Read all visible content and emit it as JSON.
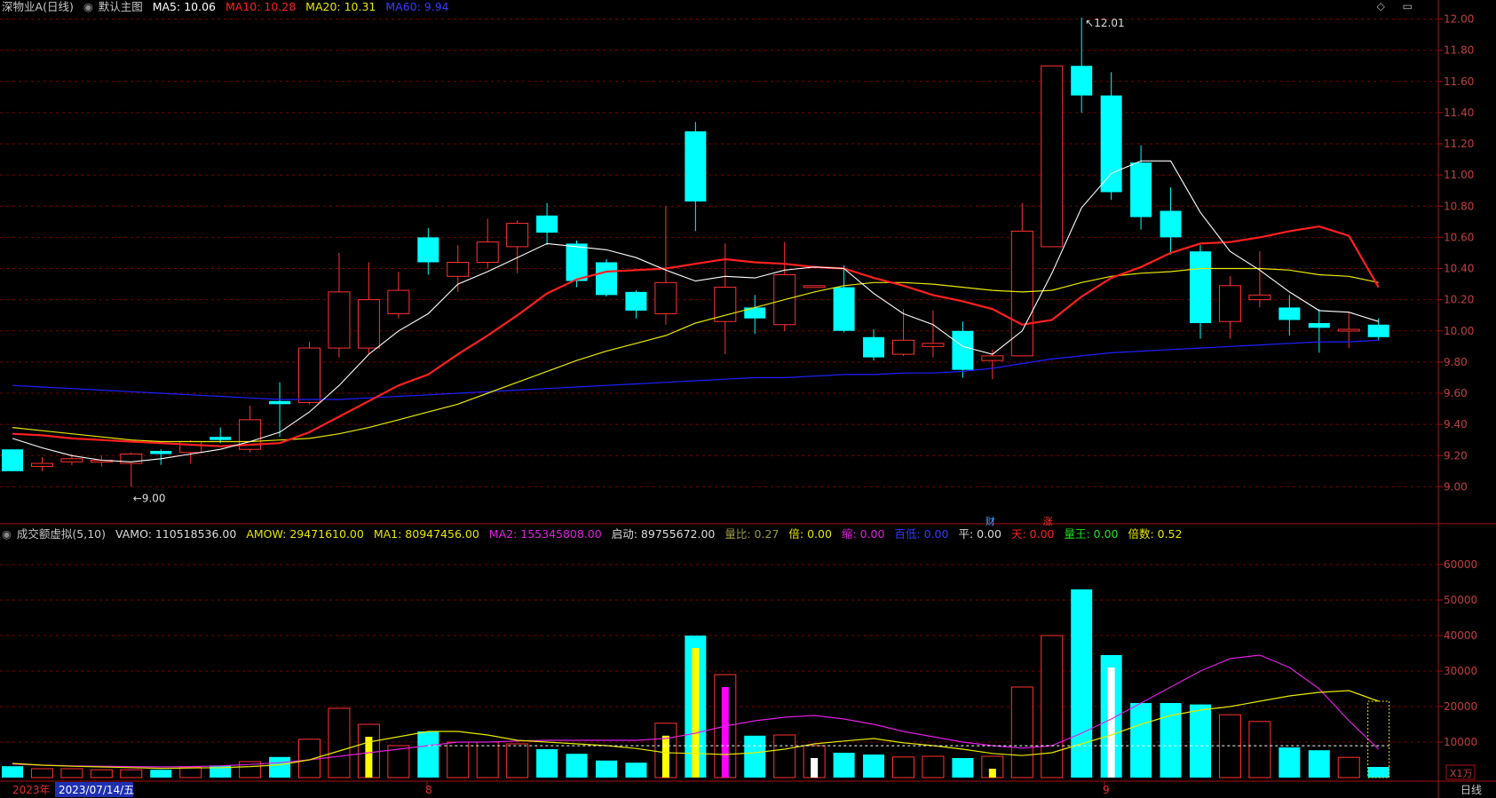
{
  "main_legend": {
    "title": "深物业A",
    "period": "(日线)",
    "mode_label": "默认主图",
    "ma5": "MA5: 10.06",
    "ma10": "MA10: 10.28",
    "ma20": "MA20: 10.31",
    "ma60": "MA60: 9.94"
  },
  "vol_legend": {
    "name": "成交额虚拟(5,10)",
    "vamo": "VAMO: 110518536.00",
    "amow": "AMOW: 29471610.00",
    "ma1": "MA1: 80947456.00",
    "ma2": "MA2: 155345808.00",
    "start": "启动: 89755672.00",
    "ratio": "量比: 0.27",
    "bei": "倍: 0.00",
    "suo": "缩: 0.00",
    "bailow": "百低: 0.00",
    "ping": "平: 0.00",
    "tian": "天: 0.00",
    "liangwang": "量王: 0.00",
    "beishu": "倍数: 0.52"
  },
  "top_icons": "◇ ▭",
  "bottom_bar": {
    "year": "2023年",
    "date_cursor": "2023/07/14/五",
    "month_8": "8",
    "month_9": "9",
    "period_tab": "日线",
    "vol_unit": "X1万"
  },
  "markers": {
    "cai": "财",
    "zhang": "涨"
  },
  "annotations": {
    "high": "12.01",
    "low": "9.00"
  },
  "colors": {
    "up": "#ff3232",
    "down": "#00ffff",
    "ma5": "#ffffff",
    "ma10": "#ff2020",
    "ma20": "#e8e800",
    "ma60": "#2020ff",
    "grid": "#7a0000",
    "axis": "#aa1010",
    "vol_ma1": "#e8e800",
    "vol_ma2": "#e020e0"
  },
  "chart_data": [
    {
      "type": "candlestick",
      "y_ticks": [
        9.0,
        9.2,
        9.4,
        9.6,
        9.8,
        10.0,
        10.2,
        10.4,
        10.6,
        10.8,
        11.0,
        11.2,
        11.4,
        11.6,
        11.8,
        12.0
      ],
      "ylim": [
        8.82,
        12.02
      ],
      "candles": [
        {
          "o": 9.24,
          "c": 9.1,
          "h": 9.24,
          "l": 9.1
        },
        {
          "o": 9.13,
          "c": 9.15,
          "h": 9.19,
          "l": 9.1
        },
        {
          "o": 9.16,
          "c": 9.18,
          "h": 9.21,
          "l": 9.14
        },
        {
          "o": 9.16,
          "c": 9.17,
          "h": 9.2,
          "l": 9.13
        },
        {
          "o": 9.15,
          "c": 9.21,
          "h": 9.22,
          "l": 9.0
        },
        {
          "o": 9.23,
          "c": 9.21,
          "h": 9.24,
          "l": 9.14
        },
        {
          "o": 9.22,
          "c": 9.29,
          "h": 9.3,
          "l": 9.15
        },
        {
          "o": 9.32,
          "c": 9.3,
          "h": 9.38,
          "l": 9.28
        },
        {
          "o": 9.24,
          "c": 9.43,
          "h": 9.52,
          "l": 9.22
        },
        {
          "o": 9.55,
          "c": 9.53,
          "h": 9.67,
          "l": 9.32
        },
        {
          "o": 9.54,
          "c": 9.89,
          "h": 9.93,
          "l": 9.53
        },
        {
          "o": 9.89,
          "c": 10.25,
          "h": 10.5,
          "l": 9.83
        },
        {
          "o": 9.89,
          "c": 10.2,
          "h": 10.44,
          "l": 9.85
        },
        {
          "o": 10.11,
          "c": 10.26,
          "h": 10.38,
          "l": 10.08
        },
        {
          "o": 10.6,
          "c": 10.44,
          "h": 10.66,
          "l": 10.36
        },
        {
          "o": 10.35,
          "c": 10.44,
          "h": 10.55,
          "l": 10.25
        },
        {
          "o": 10.44,
          "c": 10.57,
          "h": 10.72,
          "l": 10.4
        },
        {
          "o": 10.54,
          "c": 10.69,
          "h": 10.71,
          "l": 10.37
        },
        {
          "o": 10.74,
          "c": 10.63,
          "h": 10.82,
          "l": 10.55
        },
        {
          "o": 10.56,
          "c": 10.32,
          "h": 10.58,
          "l": 10.28
        },
        {
          "o": 10.44,
          "c": 10.23,
          "h": 10.46,
          "l": 10.22
        },
        {
          "o": 10.25,
          "c": 10.13,
          "h": 10.26,
          "l": 10.08
        },
        {
          "o": 10.11,
          "c": 10.31,
          "h": 10.8,
          "l": 10.04
        },
        {
          "o": 11.28,
          "c": 10.83,
          "h": 11.34,
          "l": 10.64
        },
        {
          "o": 10.06,
          "c": 10.28,
          "h": 10.56,
          "l": 9.85
        },
        {
          "o": 10.15,
          "c": 10.08,
          "h": 10.23,
          "l": 9.98
        },
        {
          "o": 10.04,
          "c": 10.36,
          "h": 10.57,
          "l": 10.0
        },
        {
          "o": 10.28,
          "c": 10.29,
          "h": 10.28,
          "l": 10.28
        },
        {
          "o": 10.28,
          "c": 10.0,
          "h": 10.42,
          "l": 9.99
        },
        {
          "o": 9.96,
          "c": 9.83,
          "h": 10.01,
          "l": 9.81
        },
        {
          "o": 9.85,
          "c": 9.94,
          "h": 10.14,
          "l": 9.84
        },
        {
          "o": 9.9,
          "c": 9.92,
          "h": 10.13,
          "l": 9.83
        },
        {
          "o": 10.0,
          "c": 9.75,
          "h": 10.06,
          "l": 9.7
        },
        {
          "o": 9.81,
          "c": 9.84,
          "h": 9.88,
          "l": 9.69
        },
        {
          "o": 9.84,
          "c": 10.64,
          "h": 10.82,
          "l": 9.84
        },
        {
          "o": 10.54,
          "c": 11.7,
          "h": 11.7,
          "l": 10.54
        },
        {
          "o": 11.7,
          "c": 11.51,
          "h": 12.01,
          "l": 11.4
        },
        {
          "o": 11.51,
          "c": 10.89,
          "h": 11.66,
          "l": 10.84
        },
        {
          "o": 11.08,
          "c": 10.73,
          "h": 11.19,
          "l": 10.65
        },
        {
          "o": 10.77,
          "c": 10.6,
          "h": 10.92,
          "l": 10.49
        },
        {
          "o": 10.51,
          "c": 10.05,
          "h": 10.55,
          "l": 9.95
        },
        {
          "o": 10.06,
          "c": 10.29,
          "h": 10.35,
          "l": 9.95
        },
        {
          "o": 10.2,
          "c": 10.23,
          "h": 10.51,
          "l": 10.15
        },
        {
          "o": 10.15,
          "c": 10.07,
          "h": 10.23,
          "l": 9.97
        },
        {
          "o": 10.05,
          "c": 10.02,
          "h": 10.14,
          "l": 9.86
        },
        {
          "o": 10.0,
          "c": 10.01,
          "h": 10.12,
          "l": 9.89
        },
        {
          "o": 10.04,
          "c": 9.96,
          "h": 10.08,
          "l": 9.94
        }
      ],
      "ma5": [
        9.31,
        9.25,
        9.2,
        9.17,
        9.16,
        9.18,
        9.21,
        9.24,
        9.29,
        9.35,
        9.48,
        9.65,
        9.85,
        10.0,
        10.11,
        10.3,
        10.38,
        10.47,
        10.56,
        10.54,
        10.52,
        10.47,
        10.39,
        10.32,
        10.35,
        10.34,
        10.39,
        10.41,
        10.4,
        10.24,
        10.11,
        10.04,
        9.9,
        9.85,
        10.0,
        10.37,
        10.79,
        11.01,
        11.09,
        11.09,
        10.76,
        10.51,
        10.39,
        10.25,
        10.13,
        10.12,
        10.06
      ],
      "ma10": [
        9.34,
        9.33,
        9.31,
        9.3,
        9.29,
        9.28,
        9.27,
        9.26,
        9.27,
        9.28,
        9.35,
        9.45,
        9.55,
        9.65,
        9.72,
        9.85,
        9.97,
        10.1,
        10.24,
        10.33,
        10.38,
        10.39,
        10.4,
        10.43,
        10.46,
        10.44,
        10.43,
        10.41,
        10.4,
        10.34,
        10.29,
        10.23,
        10.19,
        10.14,
        10.04,
        10.07,
        10.22,
        10.34,
        10.41,
        10.5,
        10.56,
        10.57,
        10.6,
        10.64,
        10.67,
        10.61,
        10.28
      ],
      "ma20": [
        9.38,
        9.36,
        9.34,
        9.32,
        9.3,
        9.29,
        9.29,
        9.29,
        9.29,
        9.3,
        9.31,
        9.34,
        9.38,
        9.43,
        9.48,
        9.53,
        9.6,
        9.67,
        9.74,
        9.81,
        9.87,
        9.92,
        9.97,
        10.05,
        10.1,
        10.15,
        10.2,
        10.25,
        10.29,
        10.31,
        10.31,
        10.3,
        10.28,
        10.26,
        10.25,
        10.26,
        10.31,
        10.35,
        10.37,
        10.38,
        10.4,
        10.4,
        10.4,
        10.39,
        10.36,
        10.35,
        10.31
      ],
      "ma60": [
        9.65,
        9.64,
        9.63,
        9.62,
        9.61,
        9.6,
        9.59,
        9.58,
        9.57,
        9.56,
        9.56,
        9.56,
        9.57,
        9.58,
        9.59,
        9.6,
        9.61,
        9.62,
        9.63,
        9.64,
        9.65,
        9.66,
        9.67,
        9.68,
        9.69,
        9.7,
        9.7,
        9.71,
        9.72,
        9.72,
        9.73,
        9.73,
        9.74,
        9.76,
        9.79,
        9.82,
        9.84,
        9.86,
        9.87,
        9.88,
        9.89,
        9.9,
        9.91,
        9.92,
        9.93,
        9.93,
        9.94
      ]
    },
    {
      "type": "bar",
      "unit": "X1万",
      "y_ticks": [
        10000,
        20000,
        30000,
        40000,
        50000,
        60000
      ],
      "ylim": [
        0,
        66000
      ],
      "volume": [
        3200,
        2500,
        2500,
        2200,
        2200,
        2200,
        2900,
        3400,
        4500,
        5800,
        10800,
        19500,
        15000,
        9000,
        13000,
        10000,
        10000,
        9500,
        8000,
        6700,
        4800,
        4200,
        15300,
        40000,
        29000,
        11800,
        12000,
        9000,
        7000,
        6500,
        5800,
        6000,
        5500,
        6000,
        25500,
        40000,
        53000,
        34500,
        21000,
        21000,
        20600,
        17700,
        15800,
        8500,
        7700,
        5700,
        3000
      ],
      "ma1": [
        4000,
        3500,
        3200,
        3000,
        2800,
        2600,
        2700,
        2800,
        3100,
        3600,
        5000,
        7500,
        10000,
        11500,
        13000,
        13000,
        12000,
        10500,
        10000,
        9500,
        9000,
        8200,
        7000,
        6800,
        6500,
        7000,
        8000,
        9500,
        10300,
        11000,
        9800,
        9000,
        8000,
        6800,
        6200,
        7000,
        9500,
        12000,
        15000,
        17500,
        19000,
        20000,
        21500,
        23000,
        24000,
        24500,
        21500
      ],
      "ma2": [
        3800,
        3500,
        3300,
        3200,
        3100,
        3000,
        3100,
        3300,
        3700,
        4200,
        5000,
        6000,
        7000,
        8000,
        9000,
        10000,
        10000,
        10300,
        10500,
        10500,
        10500,
        10500,
        11000,
        12500,
        14500,
        16000,
        17000,
        17500,
        16500,
        15000,
        13000,
        11500,
        10000,
        9000,
        8300,
        9000,
        12500,
        16500,
        21000,
        25500,
        30000,
        33500,
        34500,
        31000,
        25000,
        16000,
        8000
      ],
      "flags": {
        "12": "yellow",
        "22": "yellow",
        "23": "yellow",
        "24": "magenta",
        "27": "white",
        "33": "yellow",
        "37": "white"
      },
      "dashed_level": 8976
    }
  ]
}
